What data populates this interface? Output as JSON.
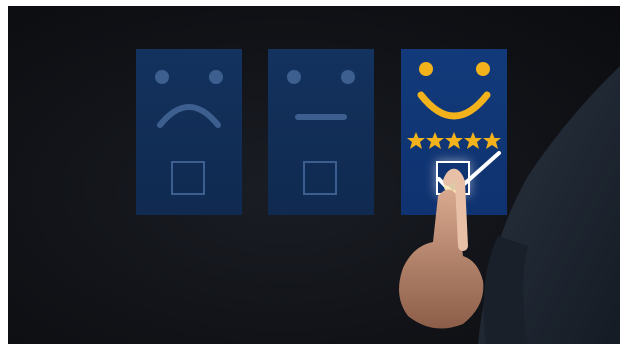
{
  "scene": {
    "panels": [
      {
        "mood": "sad",
        "selected": false
      },
      {
        "mood": "neutral",
        "selected": false
      },
      {
        "mood": "happy",
        "selected": true
      }
    ],
    "rating": {
      "stars": 5,
      "max": 5
    },
    "colors": {
      "panel": "#13325e",
      "icon_dim": "#3d5f8f",
      "icon_happy": "#f2b21b",
      "background": "#111318"
    }
  }
}
